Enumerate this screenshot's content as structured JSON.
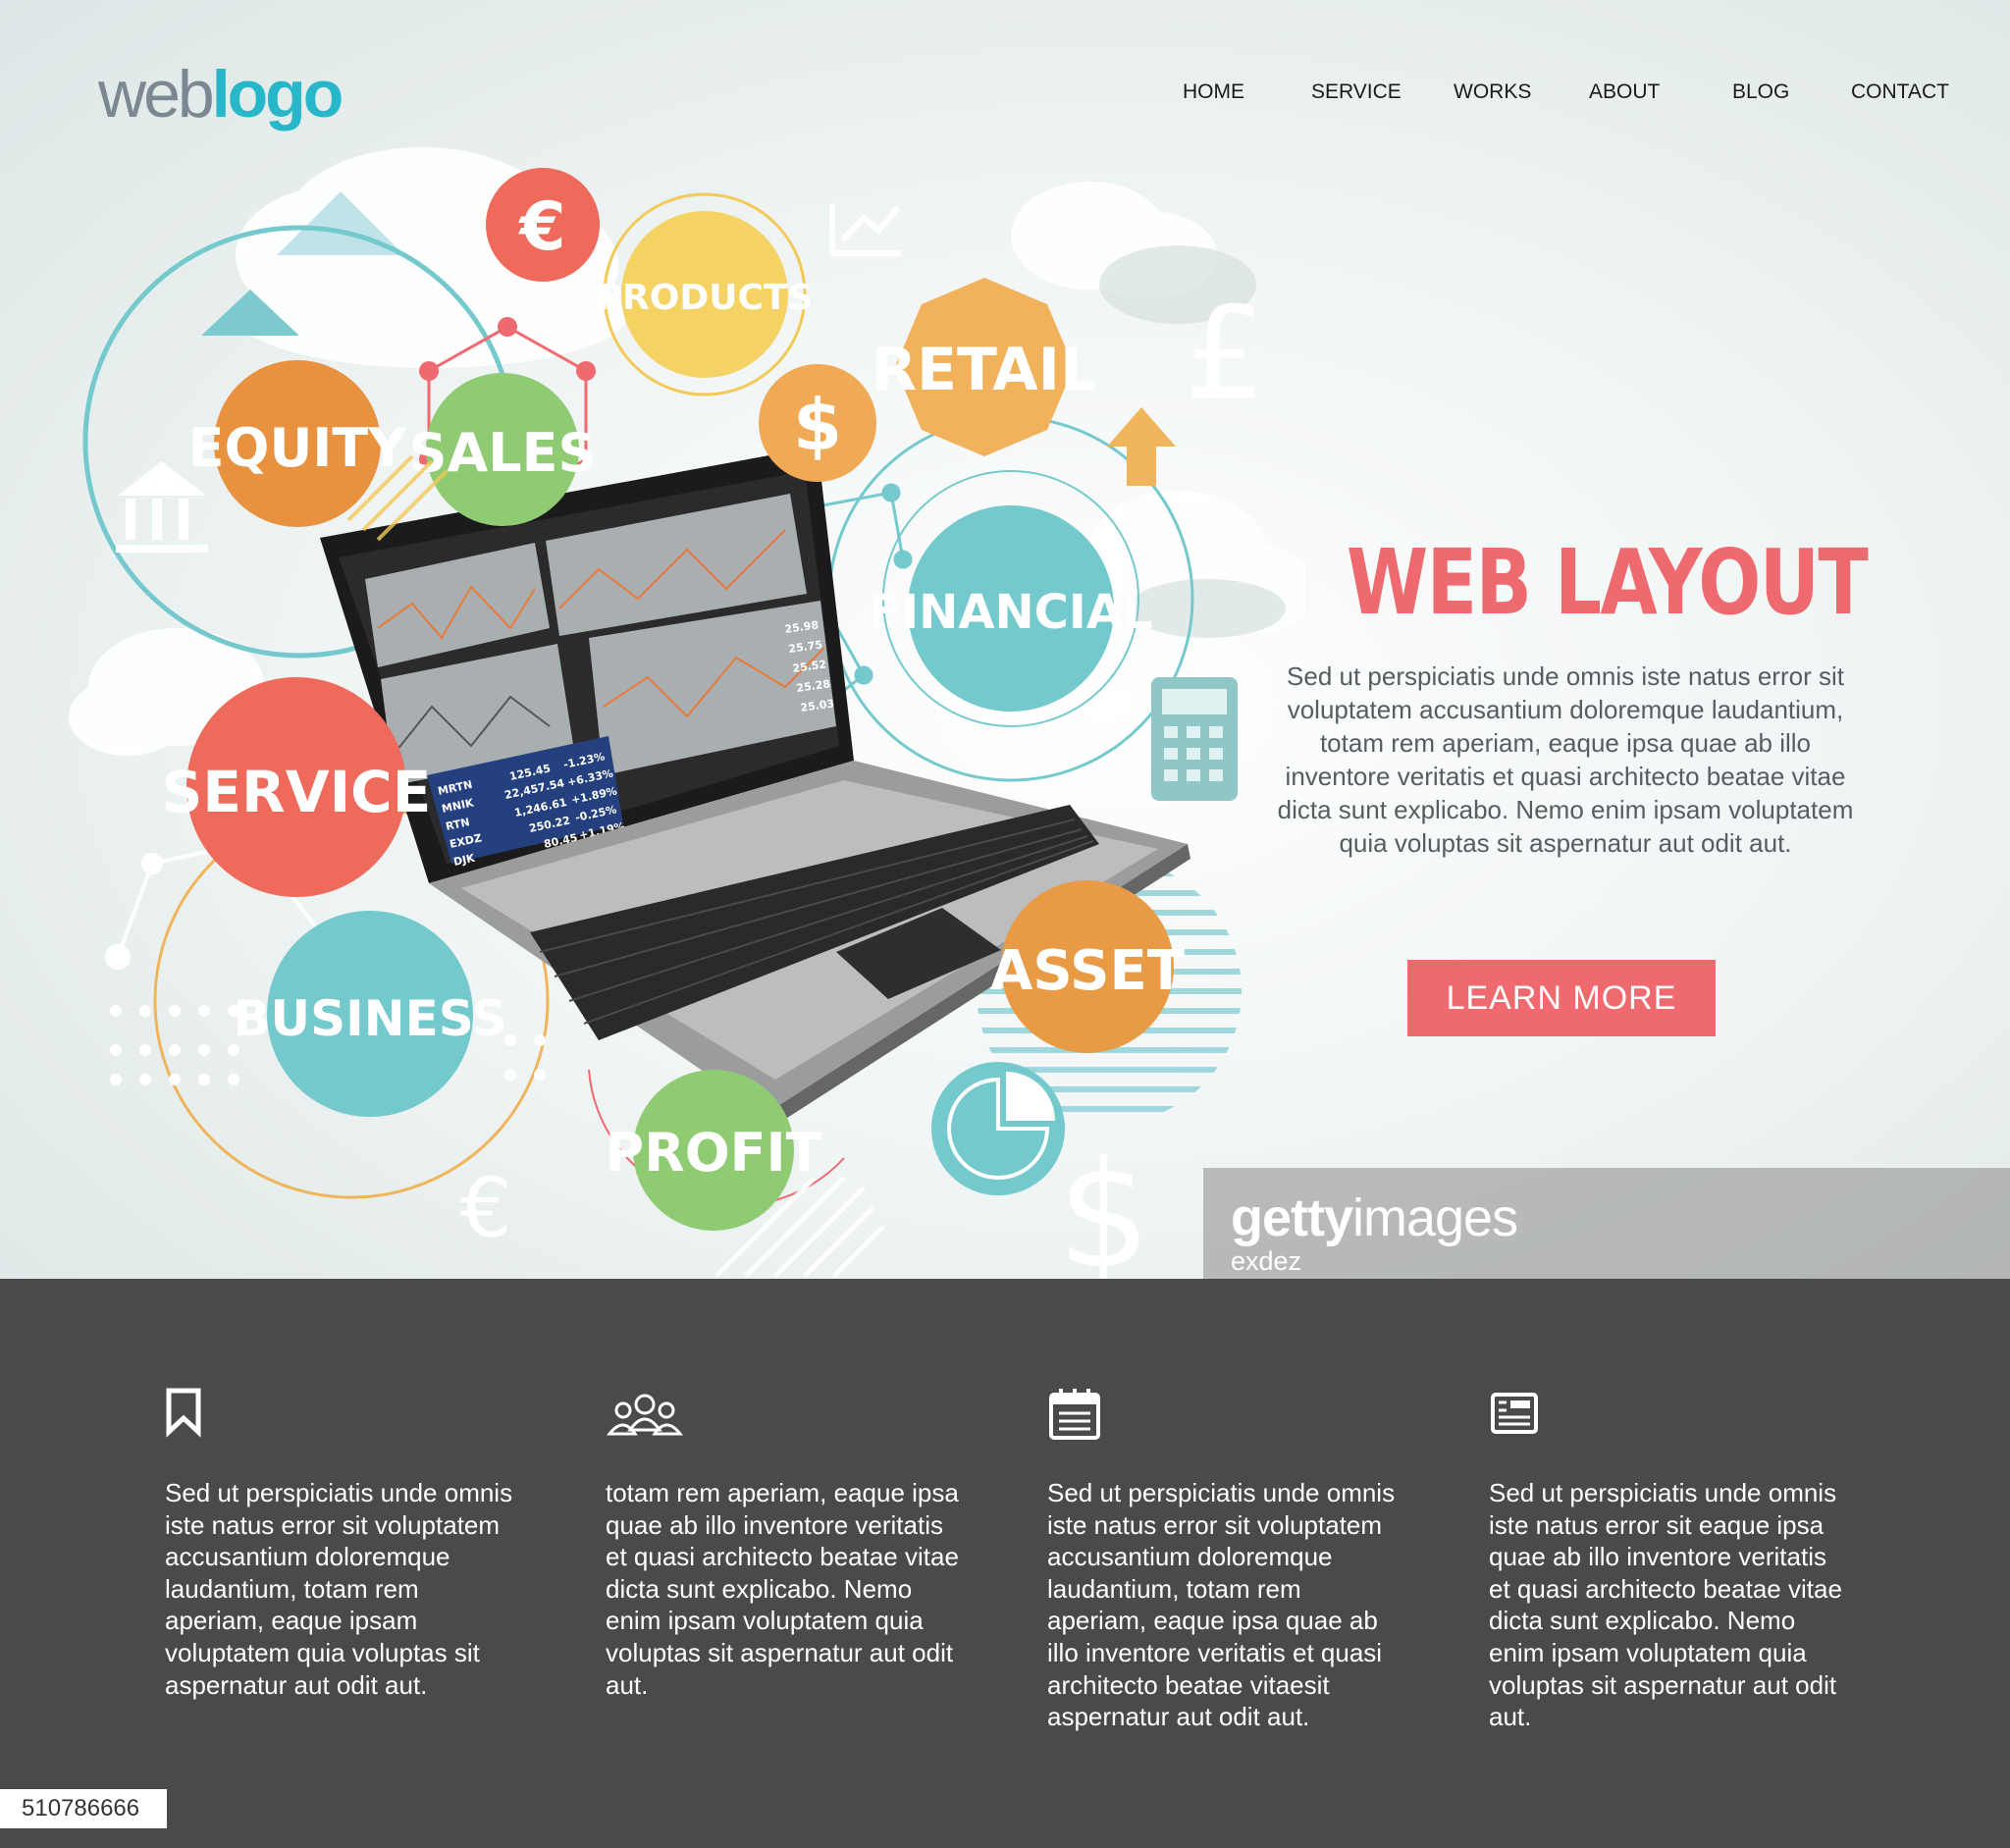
{
  "logo": {
    "part1": "web",
    "part2": "logo"
  },
  "nav": {
    "items": [
      "HOME",
      "SERVICE",
      "WORKS",
      "ABOUT",
      "BLOG",
      "CONTACT"
    ]
  },
  "illustration": {
    "bubbles": [
      "EQUITY",
      "SALES",
      "PRODUCTS",
      "RETAIL",
      "FINANCIAL",
      "SERVICE",
      "BUSINESS",
      "ASSET",
      "PROFIT"
    ],
    "symbols": [
      "€",
      "$",
      "£",
      "$",
      "€"
    ],
    "ticker": [
      {
        "symbol": "MRTN",
        "price": "125.45",
        "change": "-1.23%"
      },
      {
        "symbol": "MNIK",
        "price": "22,457.54",
        "change": "+6.33%"
      },
      {
        "symbol": "RTN",
        "price": "1,246.61",
        "change": "+1.89%"
      },
      {
        "symbol": "EXDZ",
        "price": "250.22",
        "change": "-0.25%"
      },
      {
        "symbol": "DJK",
        "price": "80.45",
        "change": "+1.19%"
      }
    ],
    "quotes": [
      "25.98",
      "25.75",
      "25.52",
      "25.28",
      "25.03"
    ]
  },
  "hero": {
    "title": "WEB LAYOUT",
    "text": "Sed ut perspiciatis unde omnis iste natus error sit voluptatem accusantium doloremque laudantium, totam rem aperiam, eaque ipsa quae ab illo inventore veritatis et quasi architecto beatae vitae dicta sunt explicabo. Nemo enim ipsam voluptatem quia voluptas sit aspernatur aut odit aut.",
    "cta_label": "LEARN MORE"
  },
  "watermark": {
    "brand_bold": "getty",
    "brand_light": "images",
    "author": "exdez"
  },
  "features": [
    {
      "icon": "bookmark-icon",
      "text": "Sed ut perspiciatis unde omnis iste natus error sit voluptatem accusantium doloremque laudantium, totam rem aperiam, eaque ipsam voluptatem quia voluptas sit aspernatur aut odit aut."
    },
    {
      "icon": "users-icon",
      "text": "totam rem aperiam, eaque ipsa quae ab illo inventore veritatis et quasi architecto beatae vitae dicta sunt explicabo. Nemo enim ipsam voluptatem quia voluptas sit aspernatur aut odit aut."
    },
    {
      "icon": "calendar-icon",
      "text": "Sed ut perspiciatis unde omnis iste natus error sit voluptatem accusantium doloremque laudantium, totam rem aperiam, eaque ipsa quae ab illo inventore veritatis et quasi architecto beatae vitaesit aspernatur aut odit aut."
    },
    {
      "icon": "newspaper-icon",
      "text": "Sed ut perspiciatis unde omnis iste natus error sit eaque ipsa quae ab illo inventore veritatis et quasi architecto beatae vitae dicta sunt explicabo. Nemo enim ipsam voluptatem quia voluptas sit aspernatur aut odit aut."
    }
  ],
  "stock_id": "510786666",
  "colors": {
    "accent_red": "#ef6a6f",
    "teal": "#74c9cd",
    "orange": "#e89a45",
    "green": "#8ecb72",
    "yellow": "#f3c95a",
    "footer_bg": "#4a4a4a"
  }
}
